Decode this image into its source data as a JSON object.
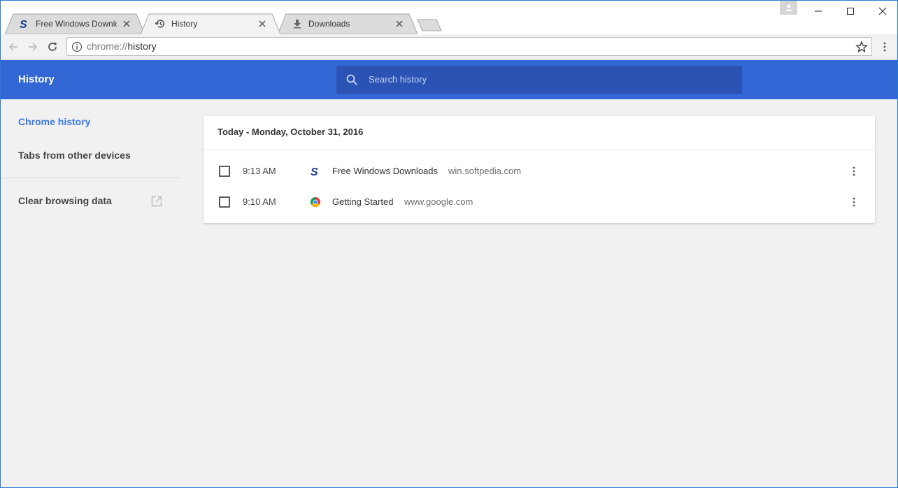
{
  "tabs": [
    {
      "title": "Free Windows Downloads",
      "icon": "softpedia-icon",
      "active": false
    },
    {
      "title": "History",
      "icon": "history-icon",
      "active": true
    },
    {
      "title": "Downloads",
      "icon": "download-icon",
      "active": false
    }
  ],
  "address_bar": {
    "scheme": "chrome://",
    "path": "history"
  },
  "header": {
    "title": "History",
    "search_placeholder": "Search history"
  },
  "sidebar": {
    "items": [
      {
        "label": "Chrome history",
        "active": true
      },
      {
        "label": "Tabs from other devices",
        "active": false
      }
    ],
    "clear_label": "Clear browsing data"
  },
  "history": {
    "date_heading": "Today - Monday, October 31, 2016",
    "entries": [
      {
        "time": "9:13 AM",
        "title": "Free Windows Downloads",
        "domain": "win.softpedia.com",
        "icon": "softpedia-icon"
      },
      {
        "time": "9:10 AM",
        "title": "Getting Started",
        "domain": "www.google.com",
        "icon": "chrome-icon"
      }
    ]
  },
  "colors": {
    "accent": "#3367d6",
    "search_bg": "#2a53b3",
    "link_active": "#3b78e7"
  }
}
